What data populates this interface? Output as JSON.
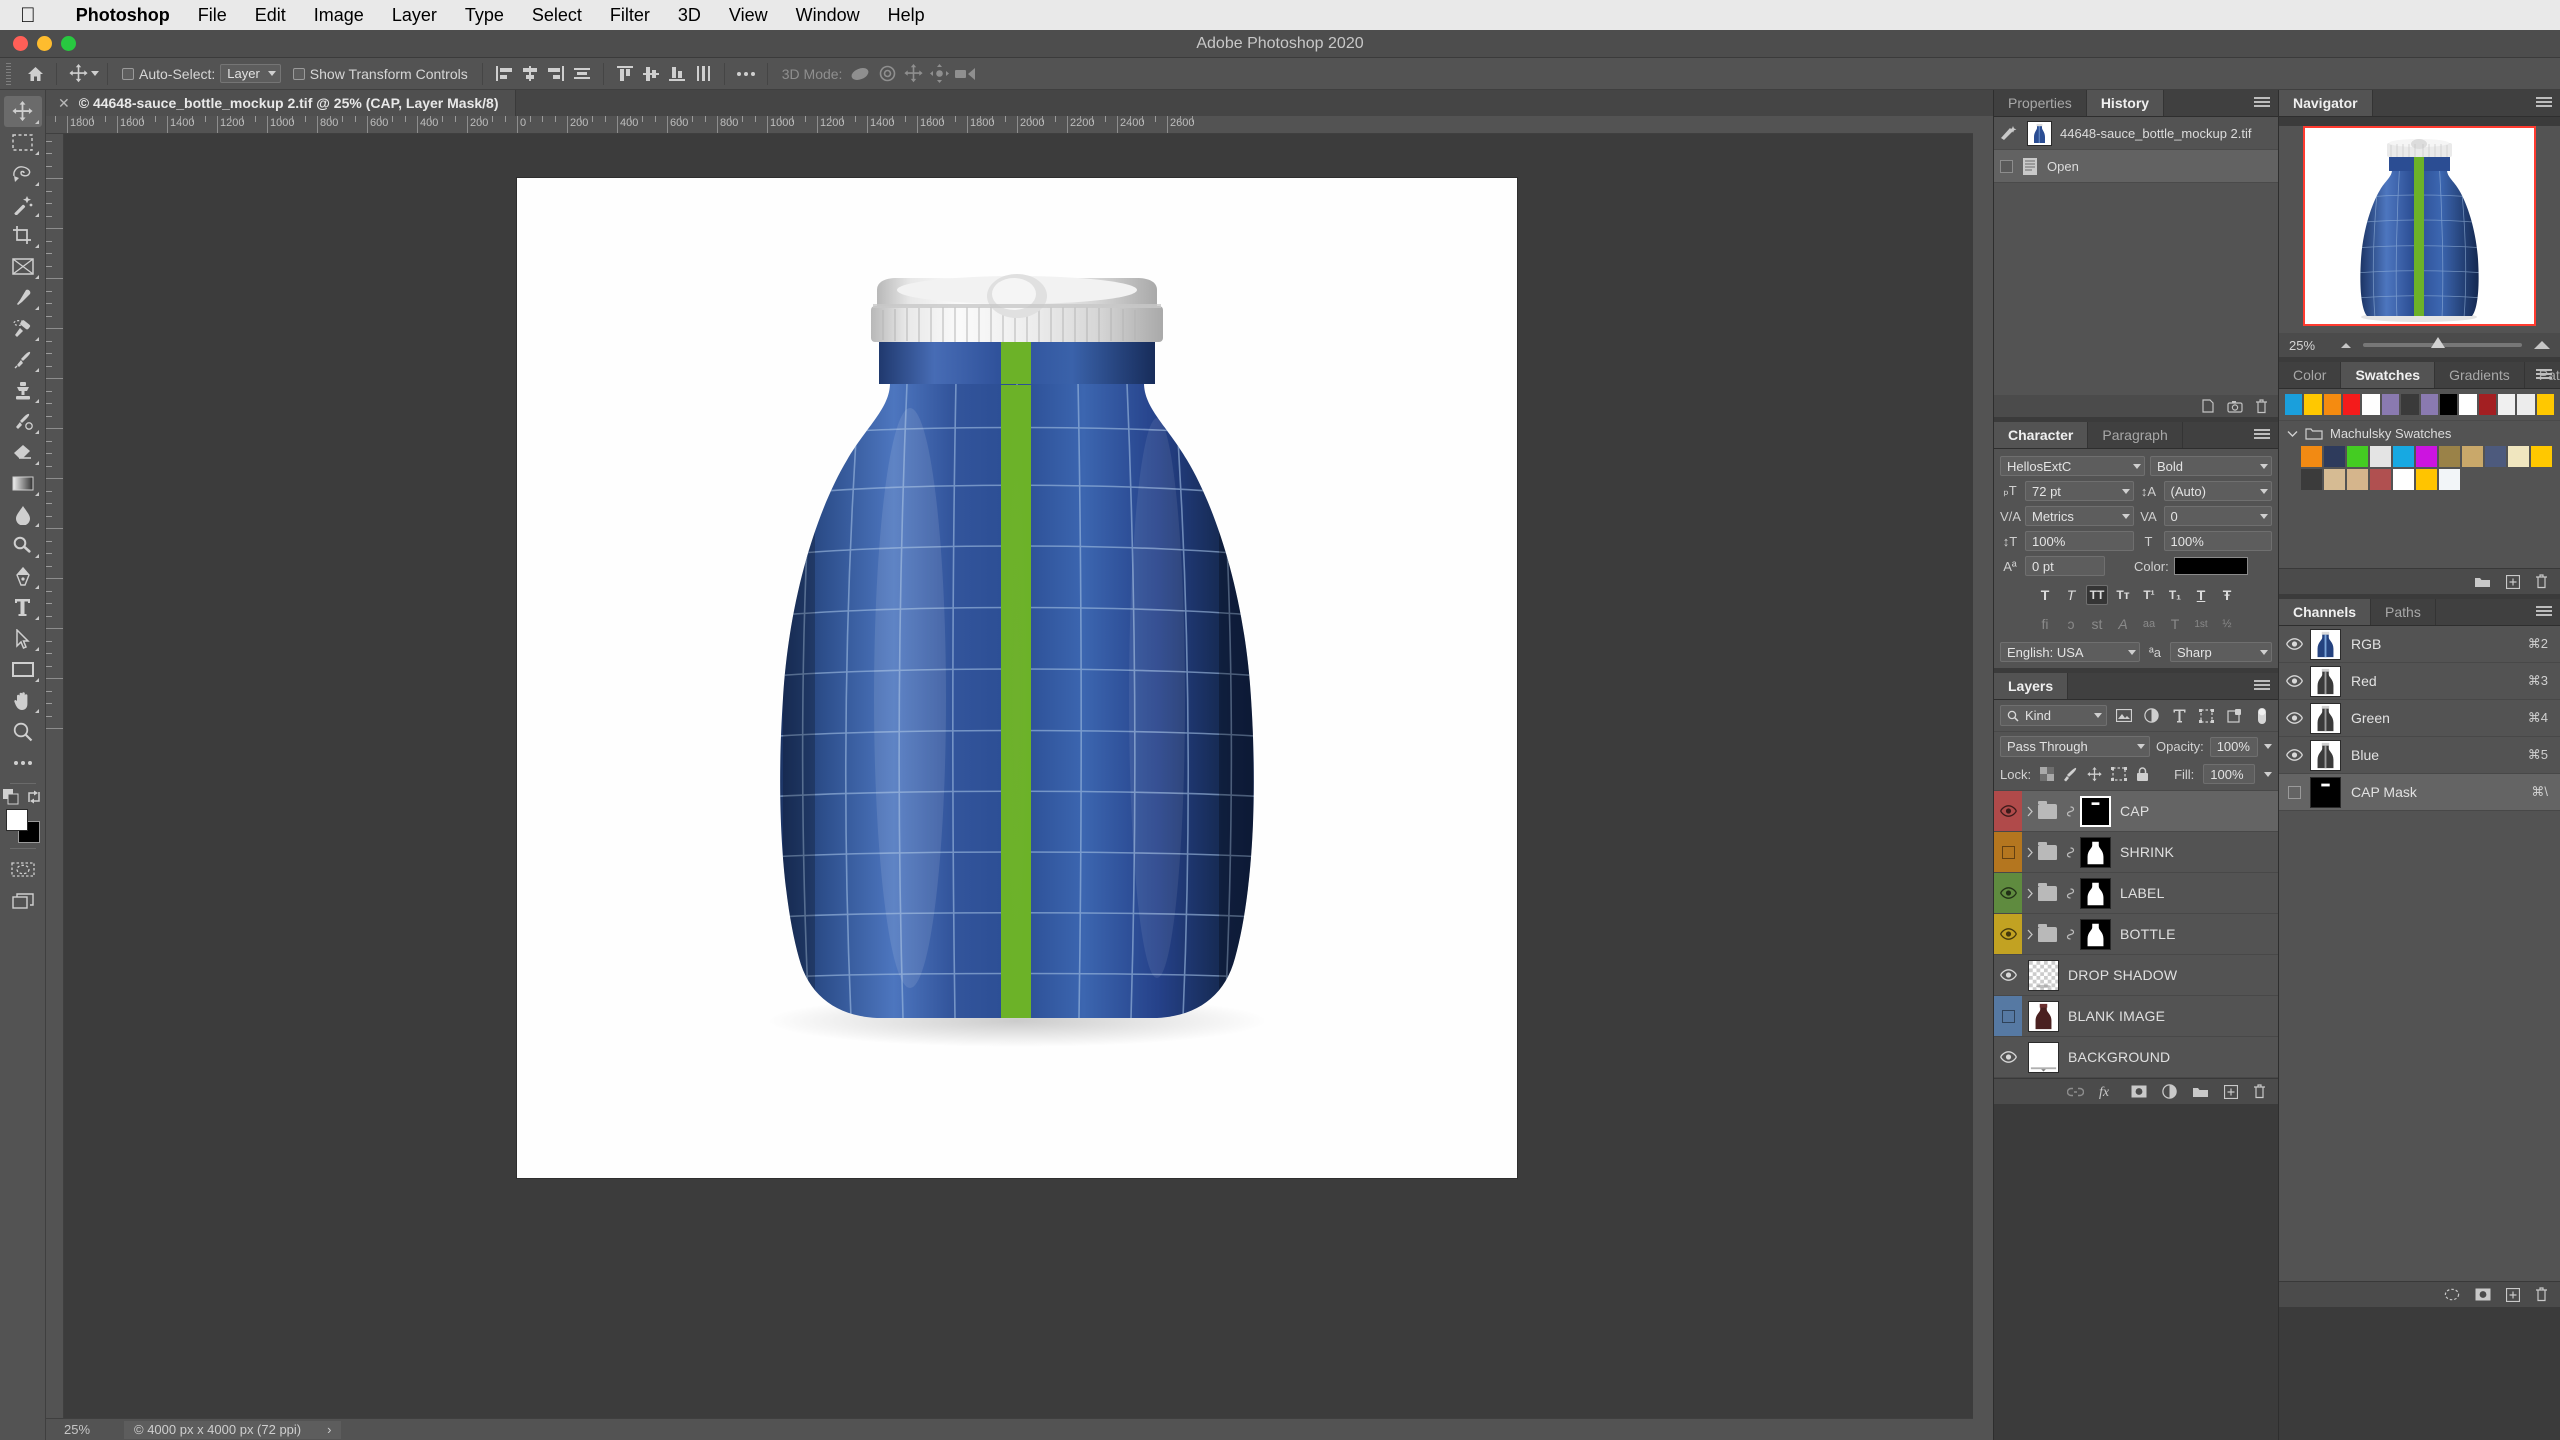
{
  "macmenu": {
    "apple_icon": "apple-logo",
    "items": [
      {
        "label": "Photoshop",
        "bold": true
      },
      {
        "label": "File"
      },
      {
        "label": "Edit"
      },
      {
        "label": "Image"
      },
      {
        "label": "Layer"
      },
      {
        "label": "Type"
      },
      {
        "label": "Select"
      },
      {
        "label": "Filter"
      },
      {
        "label": "3D"
      },
      {
        "label": "View"
      },
      {
        "label": "Window"
      },
      {
        "label": "Help"
      }
    ]
  },
  "window": {
    "title": "Adobe Photoshop 2020"
  },
  "options_bar": {
    "home_icon": "home-icon",
    "tool_icon": "move-tool-icon",
    "auto_select_label": "Auto-Select:",
    "auto_select_value": "Layer",
    "show_transform_label": "Show Transform Controls",
    "align_icons": [
      "align-left-edges-icon",
      "align-horizontal-centers-icon",
      "align-right-edges-icon",
      "distribute-horizontally-icon",
      "align-top-edges-icon",
      "align-vertical-centers-icon",
      "align-bottom-edges-icon",
      "distribute-vertically-icon"
    ],
    "more_icon": "more-options-icon",
    "mode_3d_label": "3D Mode:",
    "mode_3d_icons": [
      "orbit-3d-icon",
      "roll-3d-icon",
      "pan-3d-icon",
      "slide-3d-icon",
      "zoom-3d-icon"
    ]
  },
  "document": {
    "tab_close_icon": "close-icon",
    "tab_title": "© 44648-sauce_bottle_mockup 2.tif @ 25% (CAP, Layer Mask/8)"
  },
  "toolbox": {
    "tools": [
      {
        "name": "move-tool",
        "active": true
      },
      {
        "name": "rectangular-marquee-tool"
      },
      {
        "name": "lasso-tool"
      },
      {
        "name": "magic-wand-tool"
      },
      {
        "name": "crop-tool"
      },
      {
        "name": "frame-tool"
      },
      {
        "name": "eyedropper-tool"
      },
      {
        "name": "spot-healing-brush-tool"
      },
      {
        "name": "brush-tool"
      },
      {
        "name": "clone-stamp-tool"
      },
      {
        "name": "history-brush-tool"
      },
      {
        "name": "eraser-tool"
      },
      {
        "name": "gradient-tool"
      },
      {
        "name": "blur-tool"
      },
      {
        "name": "dodge-tool"
      },
      {
        "name": "pen-tool"
      },
      {
        "name": "horizontal-type-tool"
      },
      {
        "name": "path-selection-tool"
      },
      {
        "name": "rectangle-tool"
      },
      {
        "name": "hand-tool"
      },
      {
        "name": "zoom-tool"
      },
      {
        "name": "edit-toolbar-tool"
      }
    ],
    "foreground_color": "#ffffff",
    "background_color": "#000000",
    "quick_mask_icon": "quick-mask-icon",
    "screen_mode_icon": "screen-mode-icon"
  },
  "rulers": {
    "unit_labels_h": [
      "1800",
      "1600",
      "1400",
      "1200",
      "1000",
      "800",
      "600",
      "400",
      "200",
      "0",
      "200",
      "400",
      "600",
      "800",
      "1000",
      "1200",
      "1400",
      "1600",
      "1800",
      "2000",
      "2200",
      "2400",
      "2600"
    ],
    "unit_labels_v": [
      "800",
      "600",
      "400",
      "200",
      "0",
      "200",
      "400",
      "600",
      "800",
      "1000",
      "1200",
      "1400",
      "1600",
      "1800",
      "2000"
    ]
  },
  "status_bar": {
    "zoom": "25%",
    "doc_info": "© 4000 px x 4000 px (72 ppi)",
    "arrow_icon": "chevron-right-icon"
  },
  "history_panel": {
    "tabs": [
      {
        "label": "Properties",
        "active": false
      },
      {
        "label": "History",
        "active": true
      }
    ],
    "snapshot": "44648-sauce_bottle_mockup 2.tif",
    "states": [
      {
        "label": "Open",
        "selected": true
      }
    ],
    "footer_icons": [
      "create-document-from-state-icon",
      "create-snapshot-icon",
      "delete-state-icon"
    ]
  },
  "character_panel": {
    "tabs": [
      {
        "label": "Character",
        "active": true
      },
      {
        "label": "Paragraph",
        "active": false
      }
    ],
    "font_family": "HellosExtC",
    "font_style": "Bold",
    "font_size": "72 pt",
    "leading": "(Auto)",
    "kerning": "Metrics",
    "tracking": "0",
    "vertical_scale": "100%",
    "horizontal_scale": "100%",
    "baseline_shift": "0 pt",
    "color_label": "Color:",
    "color_value": "#000000",
    "style_buttons": [
      {
        "glyph": "T",
        "name": "faux-bold",
        "state": "off"
      },
      {
        "glyph": "T",
        "name": "faux-italic",
        "state": "off"
      },
      {
        "glyph": "TT",
        "name": "all-caps",
        "state": "on"
      },
      {
        "glyph": "Tт",
        "name": "small-caps",
        "state": "off"
      },
      {
        "glyph": "T¹",
        "name": "superscript",
        "state": "off"
      },
      {
        "glyph": "T₁",
        "name": "subscript",
        "state": "off"
      },
      {
        "glyph": "T",
        "name": "underline",
        "state": "off"
      },
      {
        "glyph": "Ŧ",
        "name": "strikethrough",
        "state": "off"
      }
    ],
    "opentype_buttons": [
      {
        "glyph": "fi",
        "name": "standard-ligatures"
      },
      {
        "glyph": "ɔ",
        "name": "contextual-alternates"
      },
      {
        "glyph": "st",
        "name": "discretionary-ligatures"
      },
      {
        "glyph": "ᵍ0",
        "name": "swash"
      },
      {
        "glyph": "aa",
        "name": "oldstyle"
      },
      {
        "glyph": "𝕋",
        "name": "titling-alternates"
      },
      {
        "glyph": "1st",
        "name": "ordinals"
      },
      {
        "glyph": "½",
        "name": "fractions"
      }
    ],
    "language": "English: USA",
    "antialias_icon": "anti-aliasing-icon",
    "antialias": "Sharp"
  },
  "layers_panel": {
    "tabs": [
      {
        "label": "Layers",
        "active": true
      }
    ],
    "filter_label": "Kind",
    "filter_icons": [
      "pixel-layers-filter-icon",
      "adjustment-layers-filter-icon",
      "type-layers-filter-icon",
      "shape-layers-filter-icon",
      "smart-object-filter-icon"
    ],
    "filter_toggle_icon": "filter-toggle-icon",
    "blend_mode": "Pass Through",
    "opacity_label": "Opacity:",
    "opacity_value": "100%",
    "lock_label": "Lock:",
    "lock_icons": [
      "lock-transparent-pixels-icon",
      "lock-image-pixels-icon",
      "lock-position-icon",
      "lock-artboard-nesting-icon",
      "lock-all-icon"
    ],
    "fill_label": "Fill:",
    "fill_value": "100%",
    "layers": [
      {
        "name": "CAP",
        "color": "#b04a4a",
        "visible": true,
        "selected": true,
        "group": true,
        "linked": true,
        "mask": "black-with-white-strip"
      },
      {
        "name": "SHRINK",
        "color": "#b4761f",
        "visible": false,
        "selected": false,
        "group": true,
        "linked": true,
        "mask": "bottle-silhouette"
      },
      {
        "name": "LABEL",
        "color": "#5f8b3f",
        "visible": true,
        "selected": false,
        "group": true,
        "linked": true,
        "mask": "bottle-silhouette"
      },
      {
        "name": "BOTTLE",
        "color": "#c2a222",
        "visible": true,
        "selected": false,
        "group": true,
        "linked": true,
        "mask": "bottle-silhouette"
      },
      {
        "name": "DROP SHADOW",
        "color": "none",
        "visible": true,
        "selected": false,
        "group": false,
        "linked": false,
        "mask": "transparent-checker"
      },
      {
        "name": "BLANK IMAGE",
        "color": "#5679a3",
        "visible": false,
        "selected": false,
        "group": false,
        "linked": false,
        "mask": "bottle-photo"
      },
      {
        "name": "BACKGROUND",
        "color": "none",
        "visible": true,
        "selected": false,
        "group": false,
        "linked": false,
        "mask": "white"
      }
    ],
    "footer_icons": [
      "link-layers-icon",
      "layer-style-fx-icon",
      "add-layer-mask-icon",
      "new-adjustment-layer-icon",
      "new-group-icon",
      "new-layer-icon",
      "delete-layer-icon"
    ]
  },
  "navigator_panel": {
    "tabs": [
      {
        "label": "Navigator",
        "active": true
      }
    ],
    "zoom_value": "25%",
    "zoom_out_icon": "zoom-out-icon",
    "zoom_in_icon": "zoom-in-icon",
    "view_box_color": "#ff3b30"
  },
  "swatches_panel": {
    "tabs": [
      {
        "label": "Color",
        "active": false
      },
      {
        "label": "Swatches",
        "active": true
      },
      {
        "label": "Gradients",
        "active": false
      },
      {
        "label": "Patterns",
        "active": false
      }
    ],
    "recent": [
      "#1a9fdc",
      "#ffc800",
      "#f58b10",
      "#f41b1b",
      "#fefefe",
      "#8a7ab0",
      "#3a3a3a",
      "#8a7ab0",
      "#000000",
      "#ffffff",
      "#a31f22",
      "#f0f0f0",
      "#ececec",
      "#ffc800"
    ],
    "group_name": "Machulsky Swatches",
    "group_expand_icon": "chevron-down-icon",
    "group_folder_icon": "folder-icon",
    "group_colors": [
      "#f28a13",
      "#2e3b5c",
      "#44cc22",
      "#e4e4e4",
      "#17a9e2",
      "#cc14e0",
      "#9a8248",
      "#c9a86a",
      "#4d5a7d",
      "#f0e6bf",
      "#ffc800",
      "#3b3b3b",
      "#d6bb93",
      "#d5b58c",
      "#b05050",
      "#ffffff",
      "#ffc400",
      "#f2f5f8"
    ]
  },
  "channels_panel": {
    "tabs": [
      {
        "label": "Channels",
        "active": true
      },
      {
        "label": "Paths",
        "active": false
      }
    ],
    "channels": [
      {
        "name": "RGB",
        "shortcut": "⌘2",
        "visible": true,
        "selected": false,
        "thumb": "rgb-bottle"
      },
      {
        "name": "Red",
        "shortcut": "⌘3",
        "visible": true,
        "selected": false,
        "thumb": "gray-bottle"
      },
      {
        "name": "Green",
        "shortcut": "⌘4",
        "visible": true,
        "selected": false,
        "thumb": "gray-bottle"
      },
      {
        "name": "Blue",
        "shortcut": "⌘5",
        "visible": true,
        "selected": false,
        "thumb": "gray-bottle"
      },
      {
        "name": "CAP Mask",
        "shortcut": "⌘\\",
        "visible": false,
        "selected": true,
        "thumb": "black-mask"
      }
    ],
    "footer_icons": [
      "load-channel-as-selection-icon",
      "save-selection-as-channel-icon",
      "new-channel-icon",
      "delete-channel-icon"
    ]
  },
  "canvas": {
    "artboard_background": "#fefefe",
    "bottle": {
      "body_color": "#2b52a0",
      "label_stripe_color": "#6cb228",
      "cap_color": "#e9e9e9",
      "grid_line_color": "#9ebce0"
    }
  }
}
